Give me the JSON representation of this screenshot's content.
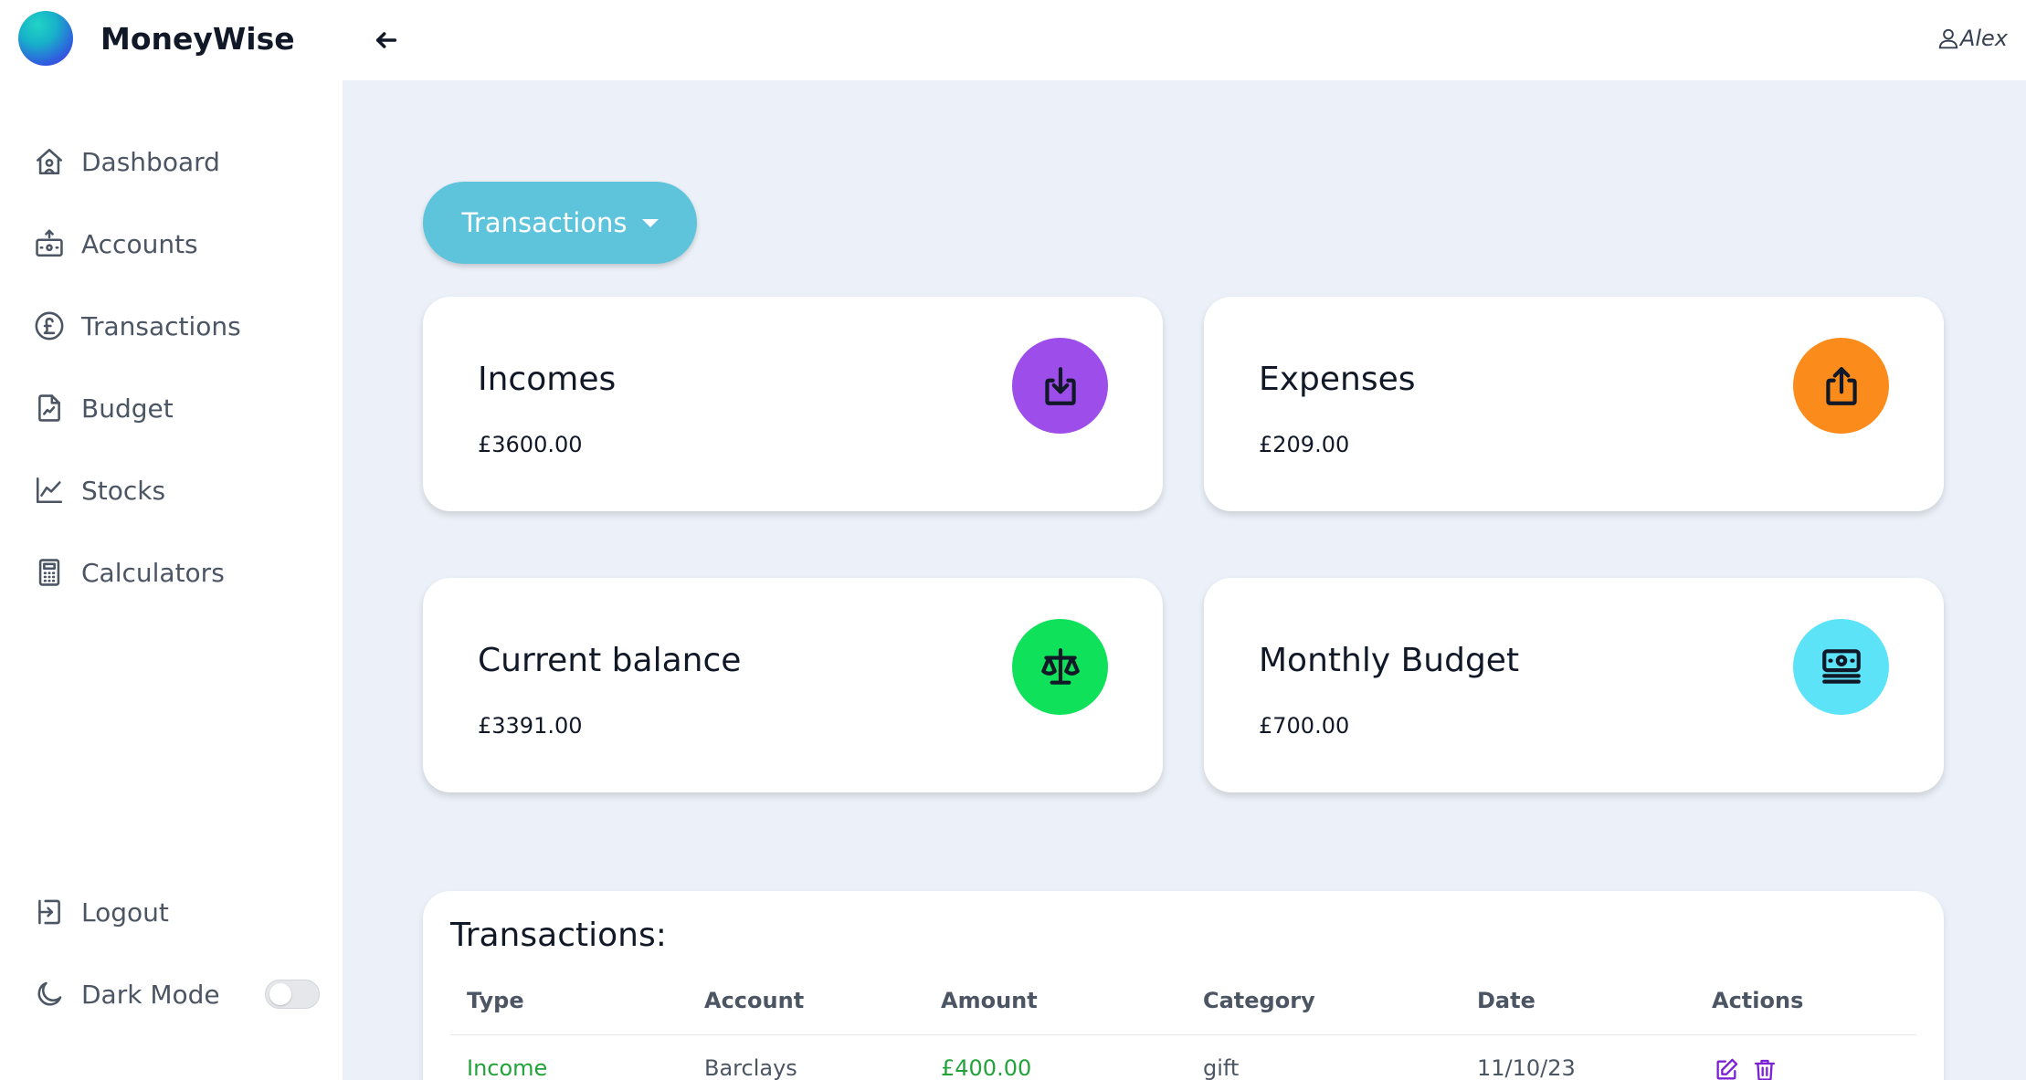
{
  "app": {
    "name": "MoneyWise"
  },
  "sidebar": {
    "items": [
      {
        "label": "Dashboard",
        "icon": "home-icon"
      },
      {
        "label": "Accounts",
        "icon": "accounts-icon"
      },
      {
        "label": "Transactions",
        "icon": "pound-circle-icon"
      },
      {
        "label": "Budget",
        "icon": "budget-document-icon"
      },
      {
        "label": "Stocks",
        "icon": "line-chart-icon"
      },
      {
        "label": "Calculators",
        "icon": "calculator-icon"
      }
    ],
    "logout_label": "Logout",
    "dark_mode_label": "Dark Mode",
    "dark_mode_enabled": false
  },
  "header": {
    "user_name": "Alex"
  },
  "main": {
    "dropdown_label": "Transactions",
    "cards": [
      {
        "title": "Incomes",
        "value": "£3600.00",
        "icon": "download-icon",
        "color": "#9d4eea"
      },
      {
        "title": "Expenses",
        "value": "£209.00",
        "icon": "upload-share-icon",
        "color": "#fb8c1c"
      },
      {
        "title": "Current balance",
        "value": "£3391.00",
        "icon": "scale-icon",
        "color": "#0fe25a"
      },
      {
        "title": "Monthly Budget",
        "value": "£700.00",
        "icon": "banknote-icon",
        "color": "#5ce3f7"
      }
    ],
    "table": {
      "title": "Transactions:",
      "columns": [
        "Type",
        "Account",
        "Amount",
        "Category",
        "Date",
        "Actions"
      ],
      "rows": [
        {
          "type": "Income",
          "account": "Barclays",
          "amount": "£400.00",
          "category": "gift",
          "date": "11/10/23"
        }
      ]
    }
  },
  "colors": {
    "accent": "#5ec4dc",
    "income_text": "#22a33a",
    "action_icon": "#7c22d6",
    "background": "#ecf1f9"
  }
}
